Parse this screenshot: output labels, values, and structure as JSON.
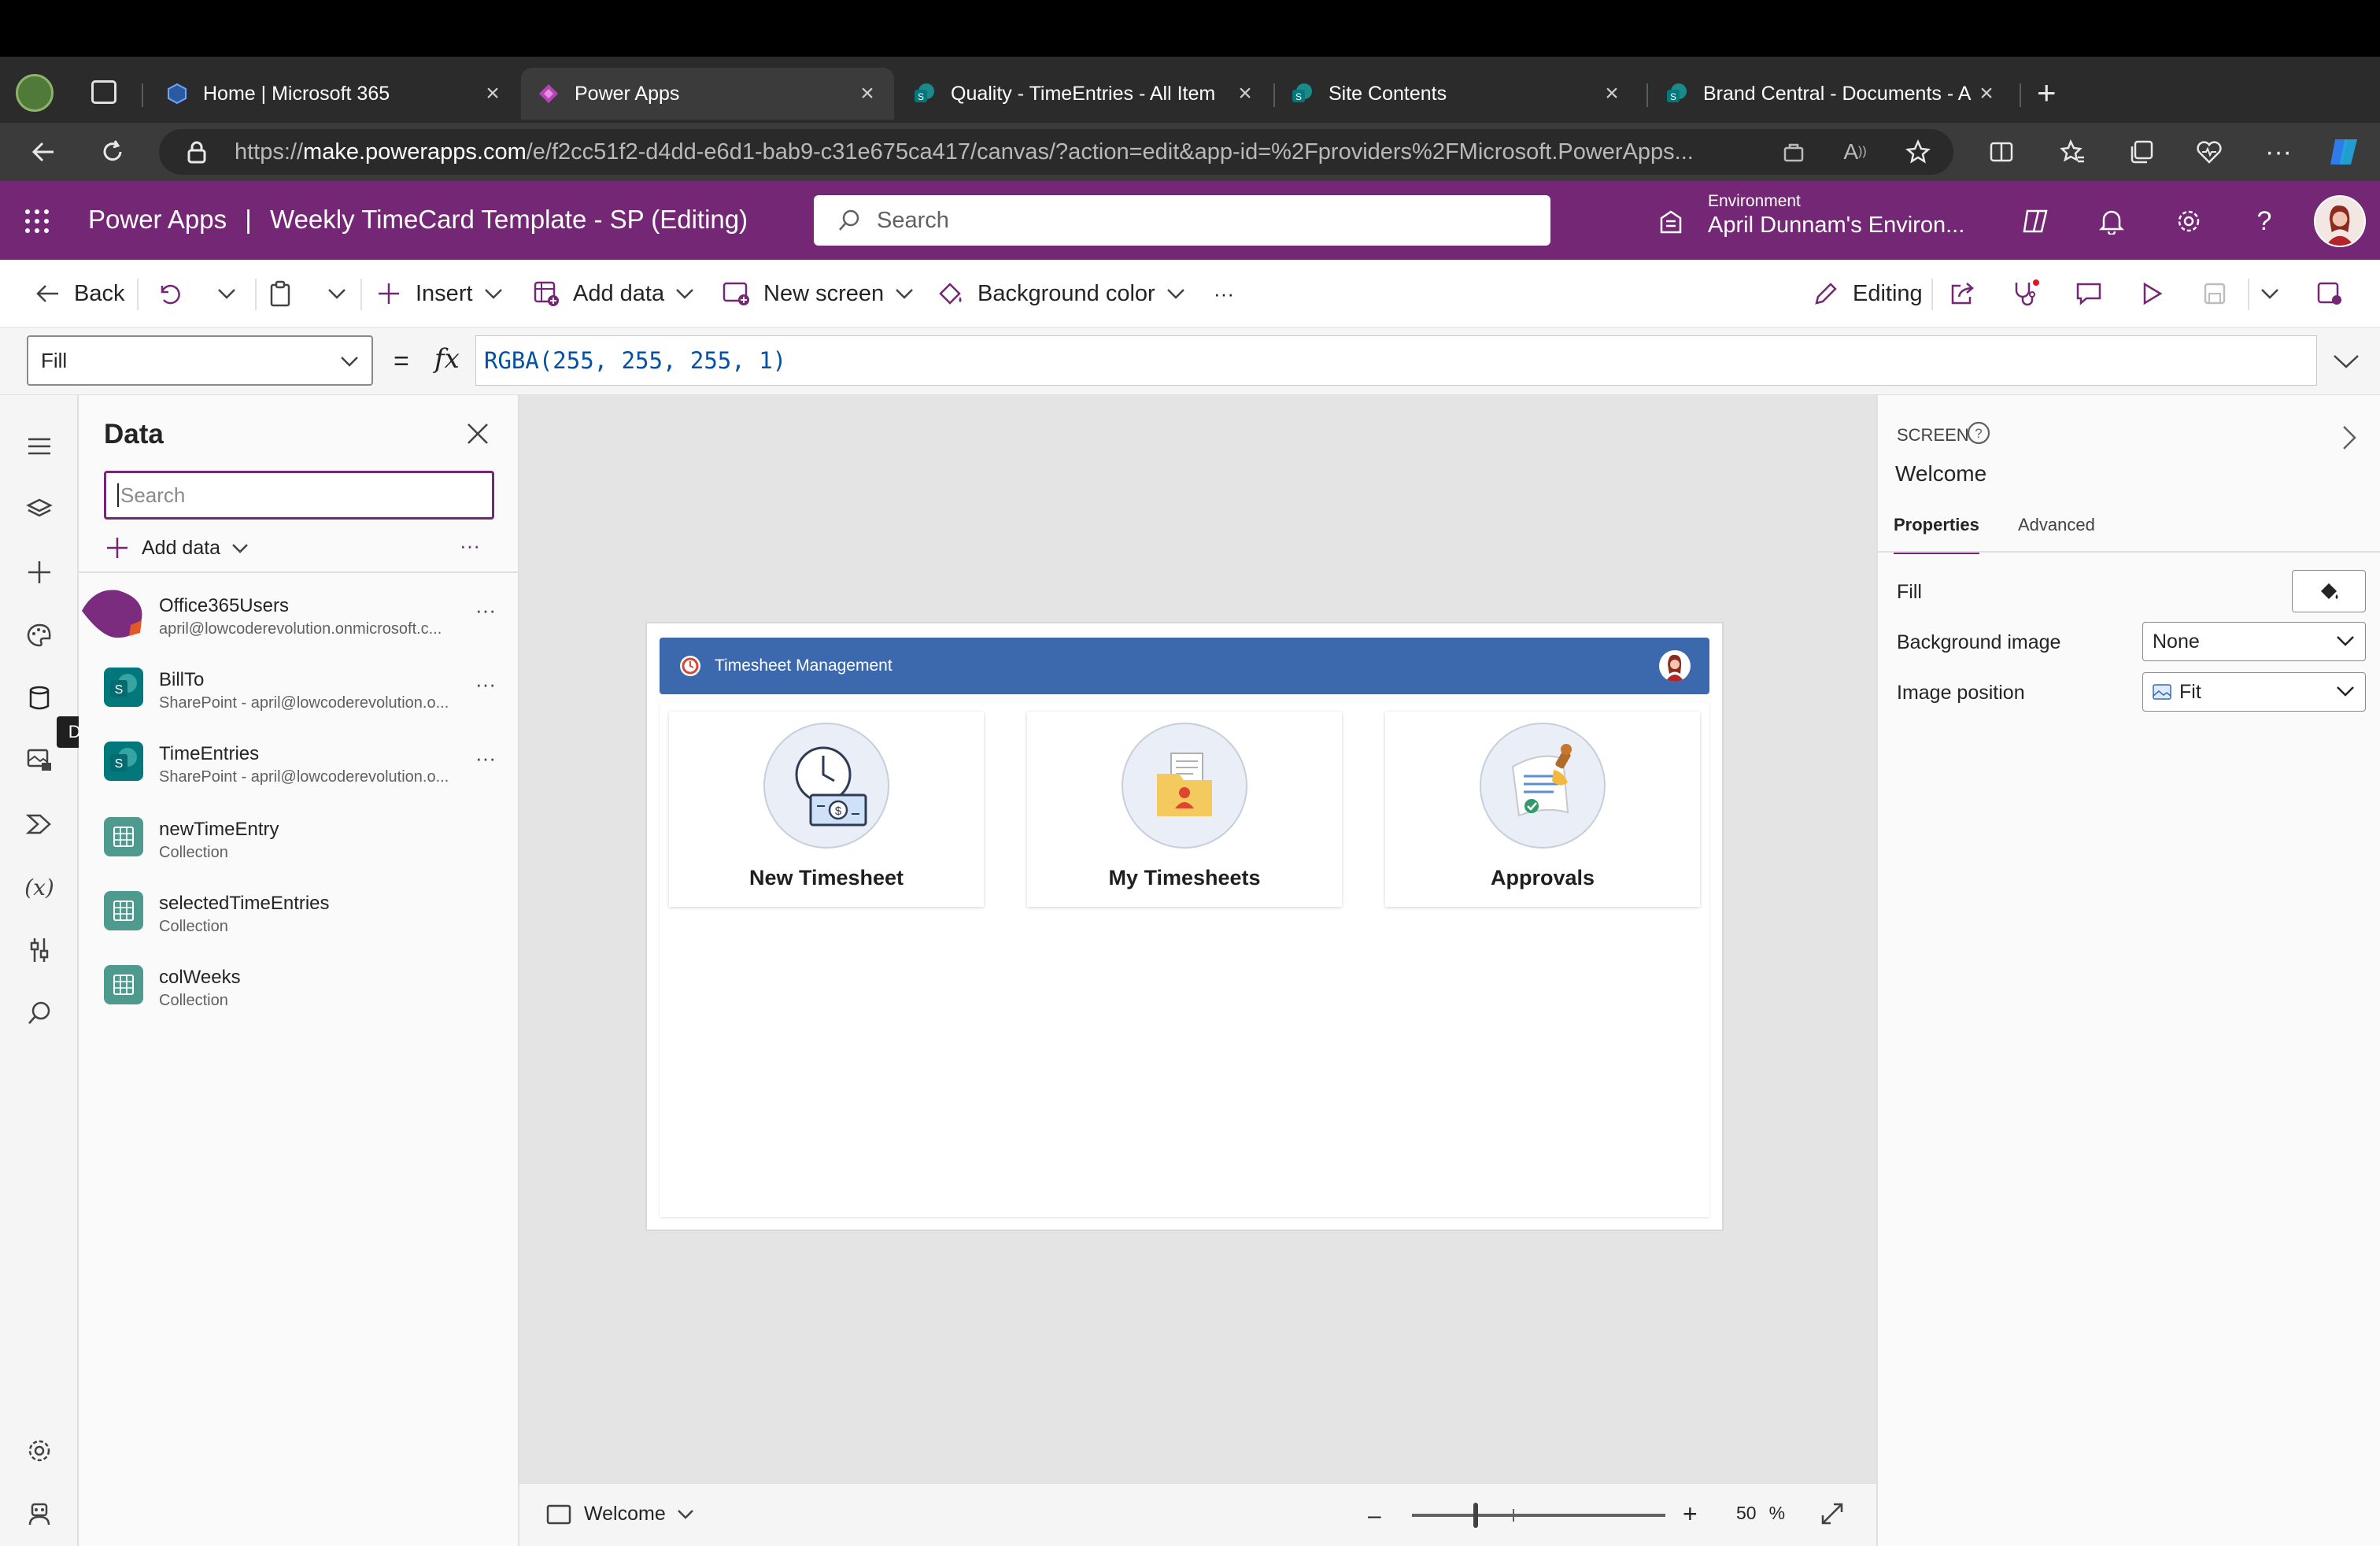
{
  "browser": {
    "tabs": [
      {
        "title": "Home | Microsoft 365",
        "icon": "m365-icon",
        "active": false
      },
      {
        "title": "Power Apps",
        "icon": "powerapps-icon",
        "active": true
      },
      {
        "title": "Quality - TimeEntries - All Item",
        "icon": "sharepoint-icon",
        "active": false
      },
      {
        "title": "Site Contents",
        "icon": "sharepoint-icon",
        "active": false
      },
      {
        "title": "Brand Central - Documents - A",
        "icon": "sharepoint-icon",
        "active": false
      }
    ],
    "url_prefix": "https://",
    "url_host": "make.powerapps.com",
    "url_rest": "/e/f2cc51f2-d4dd-e6d1-bab9-c31e675ca417/canvas/?action=edit&app-id=%2Fproviders%2FMicrosoft.PowerApps..."
  },
  "header": {
    "product": "Power Apps",
    "separator": "|",
    "app_title": "Weekly TimeCard Template - SP (Editing)",
    "search_placeholder": "Search",
    "env_label": "Environment",
    "env_name": "April Dunnam's Environ..."
  },
  "commandbar": {
    "back": "Back",
    "insert": "Insert",
    "add_data": "Add data",
    "new_screen": "New screen",
    "background_color": "Background color",
    "more": "···",
    "editing": "Editing"
  },
  "formulabar": {
    "property": "Fill",
    "equals": "=",
    "fx": "fx",
    "formula": "RGBA(255, 255, 255, 1)"
  },
  "leftrail": {
    "tooltip": "Data"
  },
  "datapanel": {
    "title": "Data",
    "search_placeholder": "Search",
    "add_data": "Add data",
    "more": "···",
    "sources": [
      {
        "name": "Office365Users",
        "sub": "april@lowcoderevolution.onmicrosoft.c...",
        "type": "office"
      },
      {
        "name": "BillTo",
        "sub": "SharePoint - april@lowcoderevolution.o...",
        "type": "sharepoint"
      },
      {
        "name": "TimeEntries",
        "sub": "SharePoint - april@lowcoderevolution.o...",
        "type": "sharepoint"
      },
      {
        "name": "newTimeEntry",
        "sub": "Collection",
        "type": "collection"
      },
      {
        "name": "selectedTimeEntries",
        "sub": "Collection",
        "type": "collection"
      },
      {
        "name": "colWeeks",
        "sub": "Collection",
        "type": "collection"
      }
    ]
  },
  "canvas": {
    "app_header_title": "Timesheet Management",
    "cards": [
      {
        "label": "New Timesheet"
      },
      {
        "label": "My Timesheets"
      },
      {
        "label": "Approvals"
      }
    ]
  },
  "statusbar": {
    "screen_name": "Welcome",
    "zoom_minus": "–",
    "zoom_plus": "+",
    "zoom_value": "50",
    "zoom_unit": "%",
    "zoom_level": 0.5
  },
  "rightpanel": {
    "section": "SCREEN",
    "screen_name": "Welcome",
    "tab_properties": "Properties",
    "tab_advanced": "Advanced",
    "fill_label": "Fill",
    "bgimage_label": "Background image",
    "bgimage_value": "None",
    "imgpos_label": "Image position",
    "imgpos_value": "Fit"
  },
  "colors": {
    "brand": "#742774",
    "app_header": "#3c68ad",
    "browser_dark": "#2b2b2b"
  }
}
